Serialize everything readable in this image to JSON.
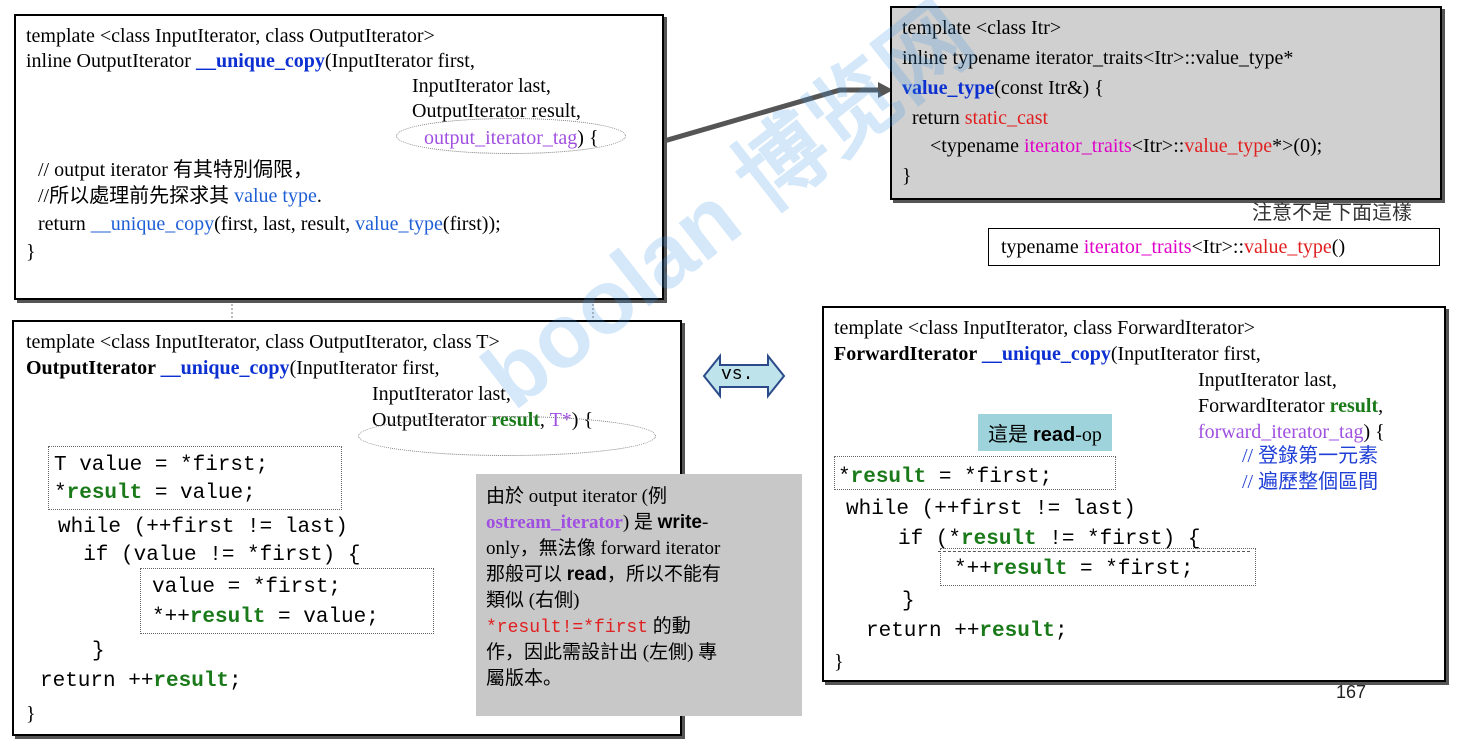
{
  "box_top_left": {
    "l1": "template <class InputIterator, class OutputIterator>",
    "l2a": "inline OutputIterator ",
    "l2fn": "__unique_copy",
    "l2b": "(InputIterator first,",
    "l3": "InputIterator last,",
    "l4": "OutputIterator result,",
    "l5tag": "output_iterator_tag",
    "l5b": ") {",
    "c1": "// output iterator 有其特別侷限，",
    "c2a": "//所以處理前先探求其 ",
    "c2b": "value type",
    "c2c": ".",
    "r_a": "return ",
    "r_fn": "__unique_copy",
    "r_b": "(first, last, result, ",
    "r_vt": "value_type",
    "r_c": "(first));",
    "close": "}"
  },
  "box_top_right": {
    "l1": "template <class Itr>",
    "l2": "inline typename iterator_traits<Itr>::value_type*",
    "l3fn": "value_type",
    "l3b": "(const Itr&) {",
    "l4a": "return ",
    "l4cast": "static_cast",
    "l5a": "<typename ",
    "l5traits": "iterator_traits",
    "l5b": "<Itr>::",
    "l5vt": "value_type",
    "l5c": "*>(0);",
    "close": "}"
  },
  "note_not_this": "注意不是下面這樣",
  "alt_line": {
    "a": "typename ",
    "traits": "iterator_traits",
    "b": "<Itr>::",
    "vt": "value_type",
    "c": "()"
  },
  "box_bottom_left": {
    "l1": "template <class InputIterator, class OutputIterator, class T>",
    "l2a": "OutputIterator ",
    "l2fn": "__unique_copy",
    "l2b": "(InputIterator first,",
    "l3": "InputIterator last,",
    "l4a": "OutputIterator ",
    "l4res": "result",
    "l4b": ", ",
    "l4t": "T*",
    "l4c": ") {",
    "c1": "T value = *first;",
    "c2a": "*",
    "c2res": "result",
    "c2b": " = value;",
    "c3": "while (++first != last)",
    "c4": "  if (value != *first) {",
    "c5": "value = *first;",
    "c6a": "*++",
    "c6res": "result",
    "c6b": " = value;",
    "c7": "}",
    "c8a": "return ++",
    "c8res": "result",
    "c8b": ";",
    "close": "}"
  },
  "vs_label": "vs.",
  "explain_note": {
    "l1": "由於 output iterator (例",
    "l2a": "ostream_iterator",
    "l2b": ") 是 ",
    "l2c": "write",
    "l2d": "-",
    "l3": "only，無法像 forward iterator",
    "l4a": "那般可以 ",
    "l4b": "read",
    "l4c": "，所以不能有",
    "l5": "類似 (右側)",
    "l6a": "*result!=*first",
    "l6b": " 的動",
    "l7": "作，因此需設計出 (左側) 專",
    "l8": "屬版本。"
  },
  "readop": {
    "a": "這是 ",
    "b": "read",
    "c": "-op"
  },
  "box_bottom_right": {
    "l1": "template <class InputIterator, class ForwardIterator>",
    "l2a": "ForwardIterator ",
    "l2fn": "__unique_copy",
    "l2b": "(InputIterator first,",
    "l3": "InputIterator last,",
    "l4a": "ForwardIterator ",
    "l4res": "result",
    "l4b": ",",
    "l5tag": "forward_iterator_tag",
    "l5b": ") {",
    "cm1": "// 登錄第一元素",
    "cm2": "// 遍歷整個區間",
    "c1a": "*",
    "c1res": "result",
    "c1b": " = *first;",
    "c2": "while (++first != last)",
    "c3a": "if (*",
    "c3res": "result",
    "c3b": " != *first) {",
    "c4a": "*++",
    "c4res": "result",
    "c4b": " = *first;",
    "c5": "}",
    "c6a": "return ++",
    "c6res": "result",
    "c6b": ";",
    "close": "}"
  },
  "page_number": "167",
  "watermark": "boolan 博览网"
}
